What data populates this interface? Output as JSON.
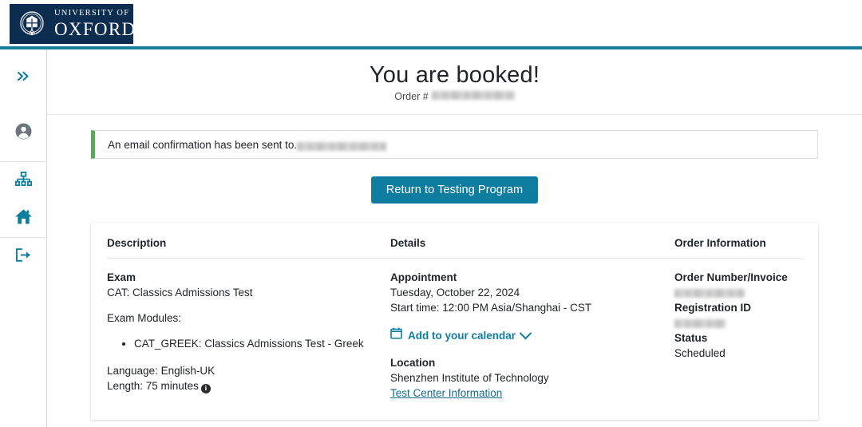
{
  "brand": {
    "logo_line1": "UNIVERSITY OF",
    "logo_line2": "OXFORD",
    "crest_name": "oxford-crest",
    "navy": "#0d2d50",
    "teal": "#157f9c",
    "accent": "#0f7da0"
  },
  "sidebar": {
    "items": [
      {
        "name": "expand-sidebar",
        "icon": "chevron-double-right-icon",
        "label": ""
      },
      {
        "name": "account",
        "icon": "account-circle-icon",
        "label": ""
      },
      {
        "name": "org-chart",
        "icon": "sitemap-icon",
        "label": ""
      },
      {
        "name": "home",
        "icon": "home-icon",
        "label": ""
      },
      {
        "name": "sign-out",
        "icon": "logout-icon",
        "label": ""
      }
    ]
  },
  "page": {
    "title": "You are booked!",
    "order_prefix": "Order #",
    "order_number_redacted": true
  },
  "alert": {
    "text": "An email confirmation has been sent to.",
    "email_redacted": true,
    "status_color": "#5aa85a"
  },
  "actions": {
    "return_button": "Return to Testing Program"
  },
  "table": {
    "headers": {
      "description": "Description",
      "details": "Details",
      "order_information": "Order Information"
    },
    "description": {
      "exam_label": "Exam",
      "exam_value": "CAT: Classics Admissions Test",
      "modules_label": "Exam Modules:",
      "modules": [
        "CAT_GREEK: Classics Admissions Test - Greek"
      ],
      "language": "Language: English-UK",
      "length": "Length: 75 minutes",
      "length_info_icon": "info-icon"
    },
    "details": {
      "appointment_label": "Appointment",
      "appointment_date": "Tuesday, October 22, 2024",
      "appointment_time": "Start time: 12:00 PM Asia/Shanghai - CST",
      "calendar_link": "Add to your calendar",
      "calendar_icon": "calendar-icon",
      "calendar_chevron": "chevron-down-icon",
      "location_label": "Location",
      "location_value": "Shenzhen Institute of Technology",
      "test_center_link": "Test Center Information"
    },
    "order_information": {
      "order_number_label": "Order Number/Invoice",
      "order_number_value_redacted": true,
      "registration_id_label": "Registration ID",
      "registration_id_value_redacted": true,
      "status_label": "Status",
      "status_value": "Scheduled"
    }
  }
}
